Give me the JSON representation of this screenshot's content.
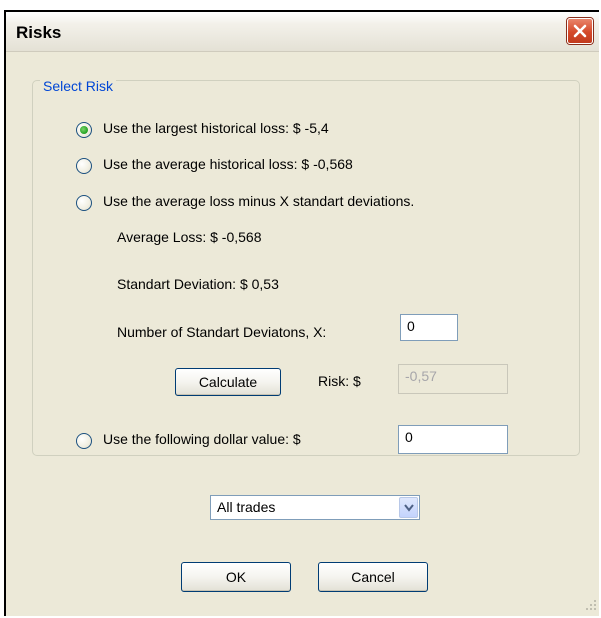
{
  "window": {
    "title": "Risks"
  },
  "group": {
    "label": "Select Risk",
    "options": [
      {
        "label": "Use the largest historical loss:  $  -5,4",
        "checked": true
      },
      {
        "label": "Use the average historical loss:  $  -0,568",
        "checked": false
      },
      {
        "label": "Use the average loss minus X standart deviations.",
        "checked": false
      },
      {
        "label": "Use the following dollar value:  $",
        "checked": false
      }
    ],
    "average_loss": "Average Loss:  $  -0,568",
    "std_dev": "Standart Deviation:  $  0,53",
    "num_std_label": "Number of Standart Deviatons, X:",
    "num_std_value": "0",
    "calculate_label": "Calculate",
    "risk_label": "Risk:  $",
    "risk_value": "-0,57",
    "dollar_value": "0"
  },
  "filter": {
    "selected": "All trades"
  },
  "buttons": {
    "ok": "OK",
    "cancel": "Cancel"
  }
}
